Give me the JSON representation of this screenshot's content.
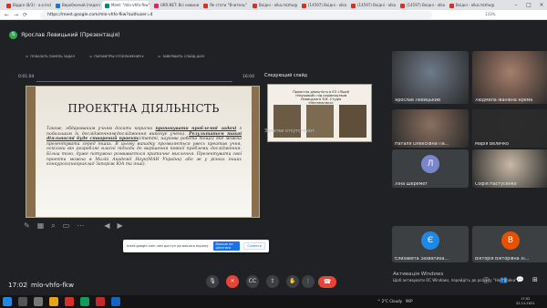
{
  "browser": {
    "tabs": [
      {
        "label": "Відділ (8/3) - o.e.lechpoltu",
        "color": "#d93025"
      },
      {
        "label": "Виробничий (педагогічна)",
        "color": "#1a73e8"
      },
      {
        "label": "Meet: \"mlo-vhfo-fkw\"",
        "color": "#00897b"
      },
      {
        "label": "UKR.NET: Всі новини Україн",
        "color": "#e91e63"
      },
      {
        "label": "Як стати \"Вчитель\" видання",
        "color": "#d93025"
      },
      {
        "label": "Вхідні - olka.mizho@g",
        "color": "#d93025"
      },
      {
        "label": "(14597) Вхідні - olka.mizho@",
        "color": "#d93025"
      },
      {
        "label": "(14597) Вхідні - olka.mizho@",
        "color": "#d93025"
      },
      {
        "label": "(14597) Вхідні - olka.mizho@",
        "color": "#d93025"
      },
      {
        "label": "Вхідні - olka.mizho@g",
        "color": "#d93025"
      }
    ],
    "url": "https://meet.google.com/mlo-vhfo-fkw?authuser=4",
    "zoom": "133%"
  },
  "meet": {
    "presenter_title": "Ярослав Левицький (Презентація)",
    "toolbar": {
      "hide_panel": "ПОКАЗАТЬ ПАНЕЛЬ ЗАДАЧ",
      "display_params": "ПАРАМЕТРЫ ОТОБРАЖЕНИЯ ▾",
      "end_show": "ЗАВЕРШИТЬ СЛАЙД-ШОУ"
    },
    "elapsed": "0:01:04",
    "clock_right": "16:04",
    "slide": {
      "title": "ПРОЕКТНА ДІЯЛЬНІСТЬ",
      "body_1": "Також, обдарованим учням досить корисно ",
      "body_bold_1": "пропонувати проблемні задачі",
      "body_2": " з подальшим їх дослідженням(дослідження виконує учень). ",
      "body_bold_2": "Результатом такої діяльності буде створений проект",
      "body_3": "(статті, наукова робота тощо) яке можна презентувати серед інших. В цьому випадку проявляється увесь креатив учня, оскільки він розробляє власні підходи до вирішення певної проблеми дослідження. Більш того, дуже потужно розвивається критичне мислення. Презентувати свої проекти можна в Малій Академії Наук(МАН України) або ж у різних інших конкурсах(наприклад Запоріж ЮА та інші)."
    },
    "next_slide_label": "Следующий слайд",
    "next_slide_title": "Проектна діяльність в ЕЗ «Ліцей «Науковий» під керівництвом Левицького Я.В. Студія «Математика»",
    "notes": "Заметки отсутствуют.",
    "popup": {
      "message": "meet.google.com чем доступ до вашого екрану.",
      "btn_hide": "Більше не ділитися",
      "btn_close": "Сховати"
    },
    "participants": [
      {
        "name": "Ярослав Левицький",
        "kind": "video",
        "bg": "#6f7b8a"
      },
      {
        "name": "Людмила Іванівна Ярема",
        "kind": "video",
        "bg": "#a87e6b"
      },
      {
        "name": "Наталя Олексіївна Па...",
        "kind": "video",
        "bg": "#8a7060"
      },
      {
        "name": "Марія Величко",
        "kind": "video",
        "bg": "#2c2c2c"
      },
      {
        "name": "Ліна Шеремет",
        "kind": "avatar",
        "initial": "Л",
        "bg": "#7986cb"
      },
      {
        "name": "Софія Настусенко",
        "kind": "video",
        "bg": "#c8b9a6"
      },
      {
        "name": "Єлизавета Захватиха...",
        "kind": "avatar",
        "initial": "Є",
        "bg": "#1e88e5"
      },
      {
        "name": "Вікторія Вікторівна Хі...",
        "kind": "avatar",
        "initial": "В",
        "bg": "#e65100"
      }
    ],
    "clock": "17:02",
    "meeting_code": "mlo-vhfo-fkw",
    "activate_windows_1": "Активація Windows",
    "activate_windows_2": "Щоб активувати ОС Windows, перейдіть до розділу \"Настройки\"."
  },
  "taskbar": {
    "tray_text": "^  2°C  Cloudy",
    "lang": "УКР",
    "time": "17:02",
    "date": "22.11.2021"
  }
}
